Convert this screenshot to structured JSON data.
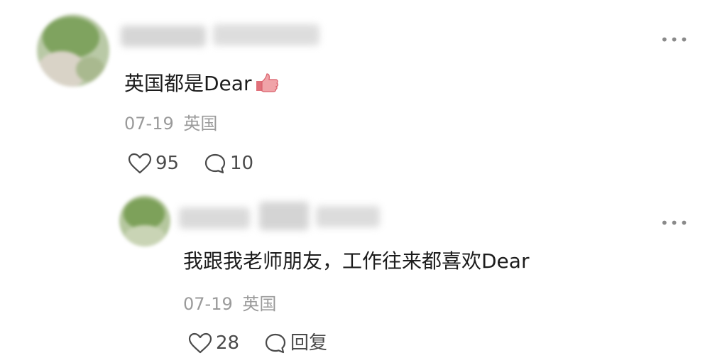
{
  "comments": [
    {
      "text": "英国都是Dear",
      "emoji": "thumbs-up-emoji",
      "date": "07-19",
      "location": "英国",
      "likes": "95",
      "replies": "10"
    },
    {
      "text": "我跟我老师朋友，工作往来都喜欢Dear",
      "date": "07-19",
      "location": "英国",
      "likes": "28",
      "reply_label": "回复"
    }
  ],
  "icons": {
    "like": "heart-outline-icon",
    "comment": "speech-bubble-icon",
    "more": "more-dots-icon"
  }
}
